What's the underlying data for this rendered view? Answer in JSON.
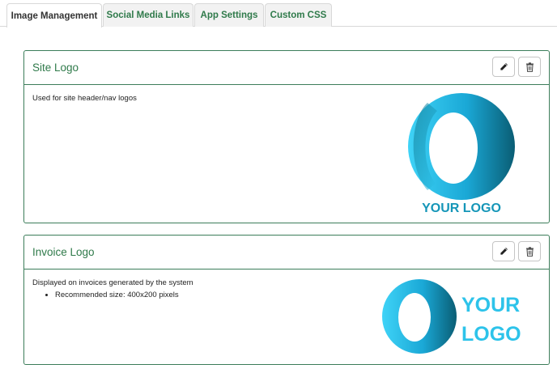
{
  "tabs": [
    {
      "label": "Image Management",
      "active": true
    },
    {
      "label": "Social Media Links",
      "active": false
    },
    {
      "label": "App Settings",
      "active": false
    },
    {
      "label": "Custom CSS",
      "active": false
    }
  ],
  "cards": [
    {
      "title": "Site Logo",
      "description": "Used for site header/nav logos",
      "bullets": [],
      "logo_text": "YOUR LOGO"
    },
    {
      "title": "Invoice Logo",
      "description": "Displayed on invoices generated by the system",
      "bullets": [
        "Recommended size: 400x200 pixels"
      ],
      "logo_text_line1": "YOUR",
      "logo_text_line2": "LOGO"
    }
  ],
  "icons": {
    "edit": "pencil-icon",
    "delete": "trash-icon"
  },
  "colors": {
    "accent_green": "#2f7a4a",
    "card_border": "#3c7d5a",
    "logo_cyan": "#2dc3ea",
    "logo_dark": "#0b6d85"
  }
}
